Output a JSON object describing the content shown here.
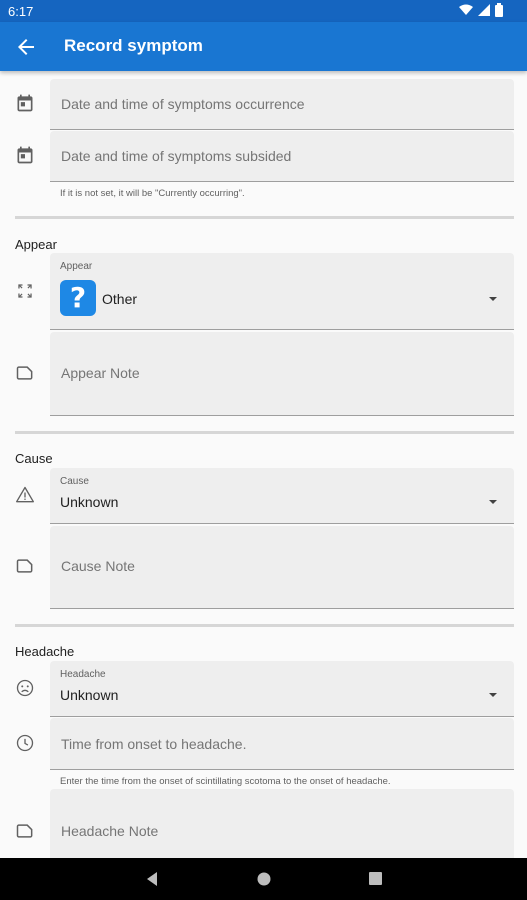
{
  "status_bar": {
    "time": "6:17"
  },
  "app_bar": {
    "title": "Record symptom"
  },
  "occurrence": {
    "placeholder": "Date and time of symptoms occurrence"
  },
  "subsided": {
    "placeholder": "Date and time of symptoms subsided",
    "helper": "If it is not set, it will be \"Currently occurring\"."
  },
  "appear": {
    "section": "Appear",
    "label": "Appear",
    "value": "Other",
    "badge_glyph": "?",
    "note_placeholder": "Appear Note"
  },
  "cause": {
    "section": "Cause",
    "label": "Cause",
    "value": "Unknown",
    "note_placeholder": "Cause Note"
  },
  "headache": {
    "section": "Headache",
    "label": "Headache",
    "value": "Unknown",
    "time_placeholder": "Time from onset to headache.",
    "time_helper": "Enter the time from the onset of scintillating scotoma to the onset of headache.",
    "note_placeholder": "Headache Note"
  },
  "colors": {
    "status_bar": "#1565c0",
    "app_bar": "#1976d2",
    "badge": "#1e88e5"
  },
  "icons": [
    "arrow-back-icon",
    "calendar-icon",
    "expand-icon",
    "note-icon",
    "warning-icon",
    "sad-face-icon",
    "clock-icon"
  ]
}
